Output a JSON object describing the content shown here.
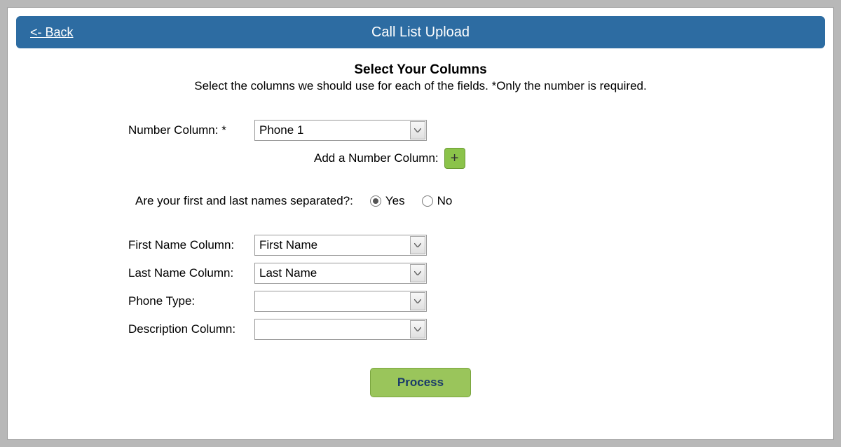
{
  "header": {
    "back_label": "<- Back",
    "title": "Call List Upload"
  },
  "section": {
    "title": "Select Your Columns",
    "description": "Select the columns we should use for each of the fields. *Only the number is required."
  },
  "form": {
    "number_column_label": "Number Column: *",
    "number_column_value": "Phone 1",
    "add_number_label": "Add a Number Column:",
    "add_number_icon": "+",
    "names_separated_label": "Are your first and last names separated?:",
    "radio_yes": "Yes",
    "radio_no": "No",
    "radio_selected": "yes",
    "first_name_label": "First Name Column:",
    "first_name_value": "First Name",
    "last_name_label": "Last Name Column:",
    "last_name_value": "Last Name",
    "phone_type_label": "Phone Type:",
    "phone_type_value": "",
    "description_label": "Description Column:",
    "description_value": ""
  },
  "buttons": {
    "process": "Process"
  }
}
